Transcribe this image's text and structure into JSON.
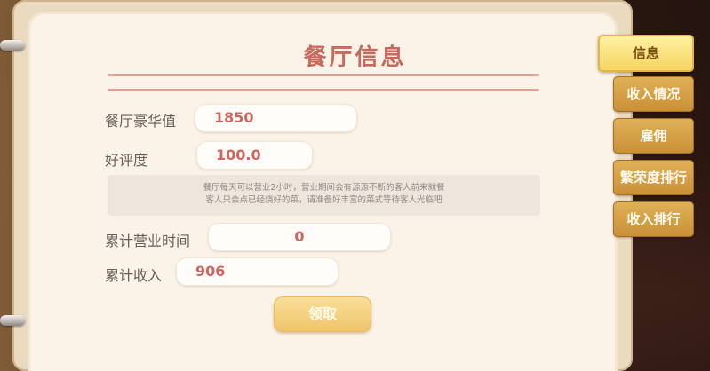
{
  "window": {
    "title": "餐厅信息"
  },
  "info": {
    "luxury_label": "餐厅豪华值",
    "luxury_value": "1850",
    "rating_label": "好评度",
    "rating_value": "100.0",
    "notice_line1": "餐厅每天可以营业2小时，营业期间会有源源不断的客人前来就餐",
    "notice_line2": "客人只会点已经烧好的菜，请准备好丰富的菜式等待客人光临吧",
    "business_time_label": "累计营业时间",
    "business_time_value": "0",
    "income_label": "累计收入",
    "income_value": "906",
    "claim_button": "领取"
  },
  "tabs": [
    {
      "label": "信息",
      "active": true
    },
    {
      "label": "收入情况",
      "active": false
    },
    {
      "label": "雇佣",
      "active": false
    },
    {
      "label": "繁荣度排行",
      "active": false
    },
    {
      "label": "收入排行",
      "active": false
    }
  ],
  "colors": {
    "title": "#c8695e",
    "value_text": "#d0645f",
    "tab_gold": "#d9a548",
    "active_tab": "#f6d45e",
    "page_bg": "#fbf3e8"
  }
}
